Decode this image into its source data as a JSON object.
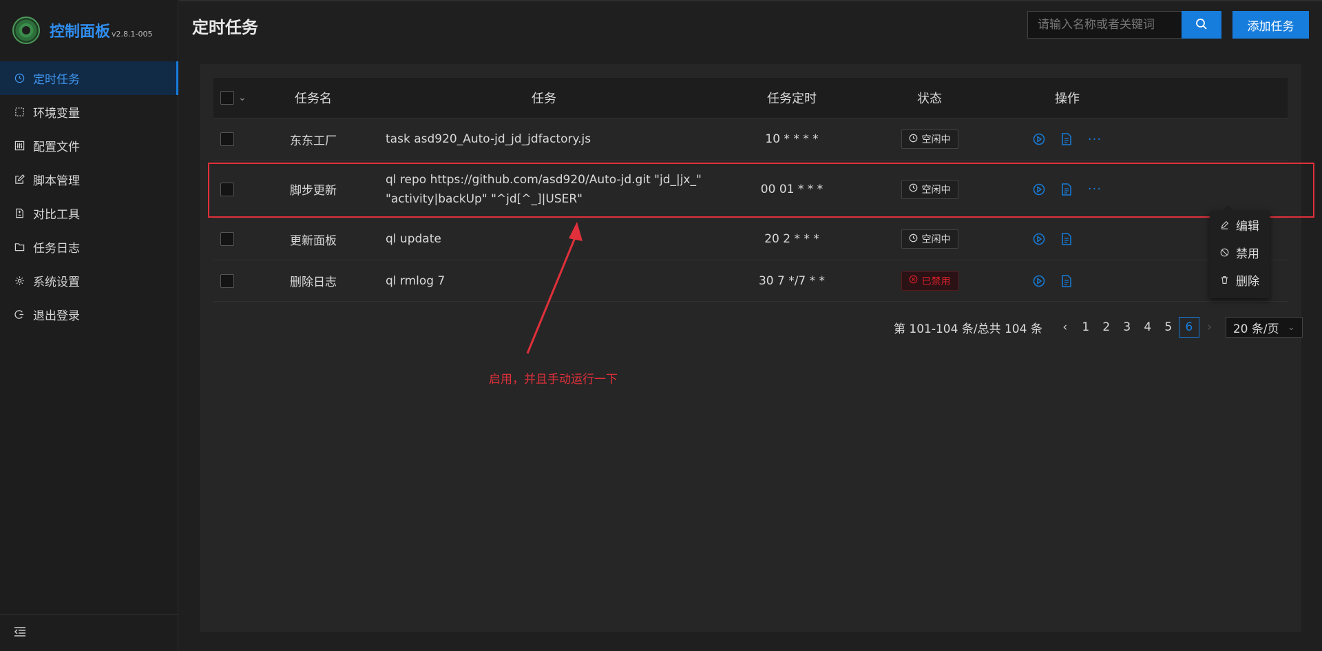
{
  "app": {
    "title": "控制面板",
    "version": "v2.8.1-005"
  },
  "sidebar": {
    "items": [
      {
        "label": "定时任务",
        "icon": "clock-icon",
        "active": true
      },
      {
        "label": "环境变量",
        "icon": "dashed-square-icon",
        "active": false
      },
      {
        "label": "配置文件",
        "icon": "sliders-icon",
        "active": false
      },
      {
        "label": "脚本管理",
        "icon": "edit-icon",
        "active": false
      },
      {
        "label": "对比工具",
        "icon": "diff-icon",
        "active": false
      },
      {
        "label": "任务日志",
        "icon": "folder-icon",
        "active": false
      },
      {
        "label": "系统设置",
        "icon": "gear-icon",
        "active": false
      },
      {
        "label": "退出登录",
        "icon": "logout-icon",
        "active": false
      }
    ],
    "collapse_icon": "menu-fold-icon"
  },
  "header": {
    "title": "定时任务",
    "search_placeholder": "请输入名称或者关键词",
    "add_label": "添加任务"
  },
  "table": {
    "columns": [
      "任务名",
      "任务",
      "任务定时",
      "状态",
      "操作"
    ],
    "rows": [
      {
        "name": "东东工厂",
        "command": "task asd920_Auto-jd_jd_jdfactory.js",
        "cron": "10 * * * *",
        "status": "空闲中",
        "status_type": "idle"
      },
      {
        "name": "脚步更新",
        "command": "ql repo https://github.com/asd920/Auto-jd.git \"jd_|jx_\" \"activity|backUp\" \"^jd[^_]|USER\"",
        "cron": "00 01 * * *",
        "status": "空闲中",
        "status_type": "idle"
      },
      {
        "name": "更新面板",
        "command": "ql update",
        "cron": "20 2 * * *",
        "status": "空闲中",
        "status_type": "idle"
      },
      {
        "name": "删除日志",
        "command": "ql rmlog 7",
        "cron": "30 7 */7 * *",
        "status": "已禁用",
        "status_type": "disabled"
      }
    ]
  },
  "dropdown": {
    "items": [
      {
        "label": "编辑",
        "icon": "pencil-icon"
      },
      {
        "label": "禁用",
        "icon": "ban-icon"
      },
      {
        "label": "删除",
        "icon": "trash-icon"
      }
    ]
  },
  "pagination": {
    "total_text": "第 101-104 条/总共 104 条",
    "pages": [
      "1",
      "2",
      "3",
      "4",
      "5",
      "6"
    ],
    "current": "6",
    "page_size": "20 条/页"
  },
  "annotation": {
    "text": "启用，并且手动运行一下",
    "color": "#e0303b"
  },
  "colors": {
    "accent": "#177ddc",
    "danger": "#d32029",
    "background": "#1f1f1f"
  }
}
